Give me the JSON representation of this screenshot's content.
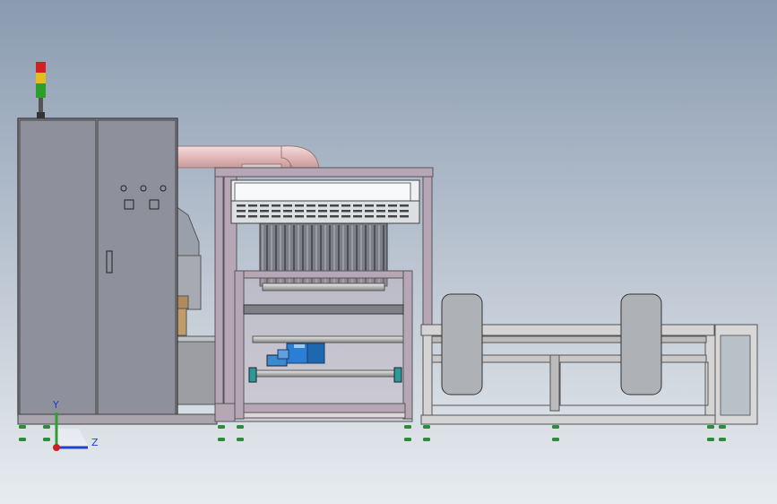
{
  "viewport": {
    "background_top": "#8a9bb0",
    "background_bottom": "#e8ecf0"
  },
  "triad": {
    "y_label": "Y",
    "z_label": "Z",
    "y_color": "#2fa02f",
    "z_color": "#2040d0",
    "origin_color": "#d02020"
  },
  "colors": {
    "cabinet": "#8e909c",
    "frame": "#b7a6b5",
    "frame_dark": "#8c7a8c",
    "duct": "#e8c4c4",
    "motor": "#2a7fd4",
    "foot": "#2f8a3a",
    "tower_red": "#d42020",
    "tower_yellow": "#e0c020",
    "tower_green": "#2aa02a",
    "conveyor": "#d4d4d4",
    "roller": "#a8a8a8"
  }
}
